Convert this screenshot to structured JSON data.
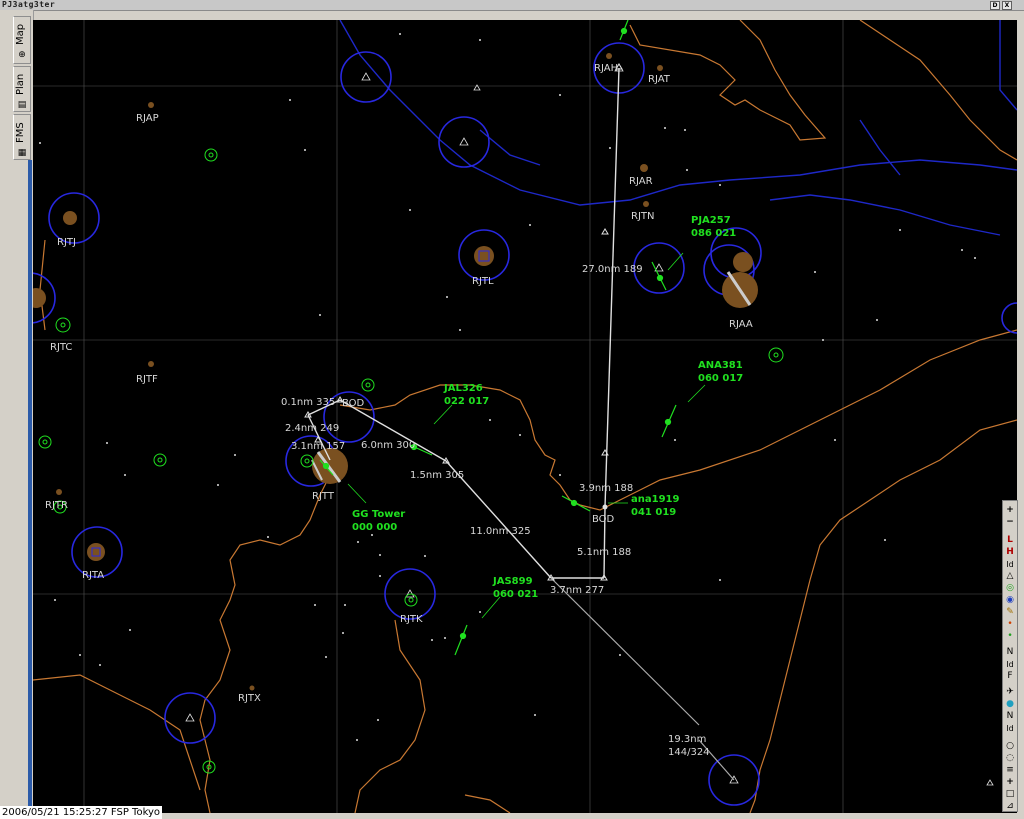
{
  "window": {
    "title": "PJ3atg3ter",
    "btn_d": "D",
    "btn_x": "X"
  },
  "tabs": [
    {
      "label": "Map",
      "icon": "⊕"
    },
    {
      "label": "Plan",
      "icon": "▤"
    },
    {
      "label": "FMS",
      "icon": "▦"
    }
  ],
  "status": {
    "text": "2006/05/21 15:25:27 FSP Tokyo"
  },
  "airports": [
    "RJAH",
    "RJAT",
    "RJAP",
    "RJAR",
    "RJTN",
    "RJTJ",
    "RJTL",
    "RJAA",
    "RJTC",
    "RJTF",
    "RJTT",
    "RJTR",
    "RJTA",
    "RJTK",
    "RJTX"
  ],
  "route": {
    "legs": [
      "0.1nm 335",
      "2.4nm 249",
      "3.1nm 157",
      "6.0nm 300",
      "1.5nm 305",
      "11.0nm 325",
      "3.7nm 277",
      "5.1nm 188",
      "3.9nm 188",
      "27.0nm 189"
    ],
    "waypoint_bod_1": "BOD",
    "waypoint_bod_2": "BOD",
    "final_leg_line1": "19.3nm",
    "final_leg_line2": "144/324"
  },
  "traffic": [
    {
      "callsign": "PJA257",
      "data": "086  021"
    },
    {
      "callsign": "ANA381",
      "data": "060  017"
    },
    {
      "callsign": "JAL326",
      "data": "022  017"
    },
    {
      "callsign": "ana1919",
      "data": "041  019"
    },
    {
      "callsign": "GG Tower",
      "data": "000  000"
    },
    {
      "callsign": "JAS899",
      "data": "060  021"
    }
  ],
  "toolbar": {
    "zoom_in": "+",
    "zoom_out": "−",
    "low": "L",
    "high": "H",
    "id": "Id",
    "n": "N",
    "id2": "Id",
    "f": "F",
    "n2": "N",
    "id3": "Id",
    "plus": "+"
  },
  "colors": {
    "map_bg": "#000000",
    "coast": "#c87832",
    "water": "#1e28c8",
    "vor_ring": "#2828e0",
    "traffic": "#20e020",
    "route": "#e0e0e0",
    "airport_fill": "#7a5020"
  }
}
